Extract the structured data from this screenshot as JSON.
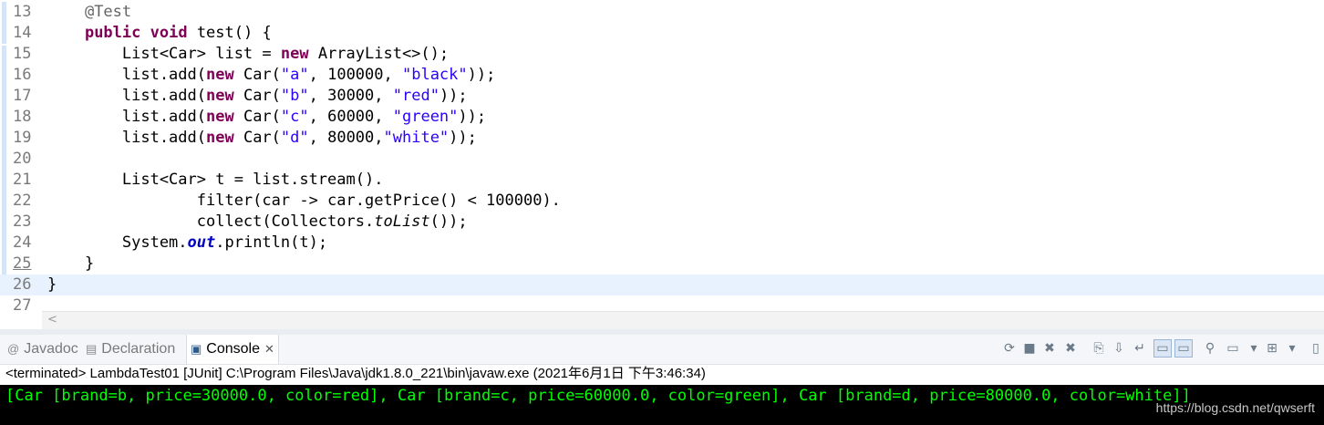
{
  "editor": {
    "lines": [
      {
        "n": "13",
        "tokens": [
          [
            "plain",
            "    "
          ],
          [
            "ann",
            "@Test"
          ]
        ]
      },
      {
        "n": "14",
        "tokens": [
          [
            "plain",
            "    "
          ],
          [
            "kw",
            "public"
          ],
          [
            "plain",
            " "
          ],
          [
            "kw",
            "void"
          ],
          [
            "plain",
            " test() {"
          ]
        ]
      },
      {
        "n": "15",
        "tokens": [
          [
            "plain",
            "        List<Car> list = "
          ],
          [
            "kw",
            "new"
          ],
          [
            "plain",
            " ArrayList<>();"
          ]
        ]
      },
      {
        "n": "16",
        "tokens": [
          [
            "plain",
            "        list.add("
          ],
          [
            "kw",
            "new"
          ],
          [
            "plain",
            " Car("
          ],
          [
            "str",
            "\"a\""
          ],
          [
            "plain",
            ", 100000, "
          ],
          [
            "str",
            "\"black\""
          ],
          [
            "plain",
            "));"
          ]
        ]
      },
      {
        "n": "17",
        "tokens": [
          [
            "plain",
            "        list.add("
          ],
          [
            "kw",
            "new"
          ],
          [
            "plain",
            " Car("
          ],
          [
            "str",
            "\"b\""
          ],
          [
            "plain",
            ", 30000, "
          ],
          [
            "str",
            "\"red\""
          ],
          [
            "plain",
            "));"
          ]
        ]
      },
      {
        "n": "18",
        "tokens": [
          [
            "plain",
            "        list.add("
          ],
          [
            "kw",
            "new"
          ],
          [
            "plain",
            " Car("
          ],
          [
            "str",
            "\"c\""
          ],
          [
            "plain",
            ", 60000, "
          ],
          [
            "str",
            "\"green\""
          ],
          [
            "plain",
            "));"
          ]
        ]
      },
      {
        "n": "19",
        "tokens": [
          [
            "plain",
            "        list.add("
          ],
          [
            "kw",
            "new"
          ],
          [
            "plain",
            " Car("
          ],
          [
            "str",
            "\"d\""
          ],
          [
            "plain",
            ", 80000,"
          ],
          [
            "str",
            "\"white\""
          ],
          [
            "plain",
            "));"
          ]
        ]
      },
      {
        "n": "20",
        "tokens": []
      },
      {
        "n": "21",
        "tokens": [
          [
            "plain",
            "        List<Car> t = list.stream()."
          ]
        ]
      },
      {
        "n": "22",
        "tokens": [
          [
            "plain",
            "                filter(car -> car.getPrice() < 100000)."
          ]
        ]
      },
      {
        "n": "23",
        "tokens": [
          [
            "plain",
            "                collect(Collectors."
          ],
          [
            "itl",
            "toList"
          ],
          [
            "plain",
            "());"
          ]
        ]
      },
      {
        "n": "24",
        "tokens": [
          [
            "plain",
            "        System."
          ],
          [
            "fld",
            "out"
          ],
          [
            "plain",
            ".println(t);"
          ]
        ]
      },
      {
        "n": "25",
        "tokens": [
          [
            "plain",
            "    }"
          ]
        ],
        "underline": true
      },
      {
        "n": "26",
        "tokens": [
          [
            "plain",
            "}"
          ]
        ],
        "highlight": true
      },
      {
        "n": "27",
        "tokens": []
      }
    ]
  },
  "view_tabs": [
    {
      "label": "Javadoc",
      "icon": "@",
      "icon_name": "javadoc-icon",
      "active": false
    },
    {
      "label": "Declaration",
      "icon": "▤",
      "icon_name": "declaration-icon",
      "active": false
    },
    {
      "label": "Console",
      "icon": "▣",
      "icon_name": "console-icon",
      "active": true
    }
  ],
  "console_tab_close": "✕",
  "toolbar": [
    {
      "name": "relaunch-icon",
      "glyph": "⟳"
    },
    {
      "name": "terminate-icon",
      "glyph": "■"
    },
    {
      "name": "remove-launch-icon",
      "glyph": "✖"
    },
    {
      "name": "remove-all-terminated-icon",
      "glyph": "✖"
    },
    {
      "name": "clear-console-icon",
      "glyph": "⎘"
    },
    {
      "name": "scroll-lock-icon",
      "glyph": "⇩"
    },
    {
      "name": "word-wrap-icon",
      "glyph": "↵"
    },
    {
      "name": "show-on-stdout-icon",
      "glyph": "▭",
      "pressed": true
    },
    {
      "name": "show-on-stderr-icon",
      "glyph": "▭",
      "pressed": true
    },
    {
      "name": "pin-console-icon",
      "glyph": "⚲"
    },
    {
      "name": "display-console-icon",
      "glyph": "▭"
    },
    {
      "name": "display-console-dropdown-icon",
      "glyph": "▾"
    },
    {
      "name": "open-console-icon",
      "glyph": "⊞"
    },
    {
      "name": "open-console-dropdown-icon",
      "glyph": "▾"
    },
    {
      "name": "minimize-icon",
      "glyph": "▯"
    }
  ],
  "status_text": "<terminated> LambdaTest01 [JUnit] C:\\Program Files\\Java\\jdk1.8.0_221\\bin\\javaw.exe (2021年6月1日 下午3:46:34)",
  "console_output": "[Car [brand=b, price=30000.0, color=red], Car [brand=c, price=60000.0, color=green], Car [brand=d, price=80000.0, color=white]]",
  "watermark": "https://blog.csdn.net/qwserft",
  "colors": {
    "keyword": "#7f0055",
    "string": "#2a00ff",
    "field": "#0000c0",
    "console_text": "#00ff00",
    "console_bg": "#000000",
    "current_line": "#e8f2fe"
  }
}
